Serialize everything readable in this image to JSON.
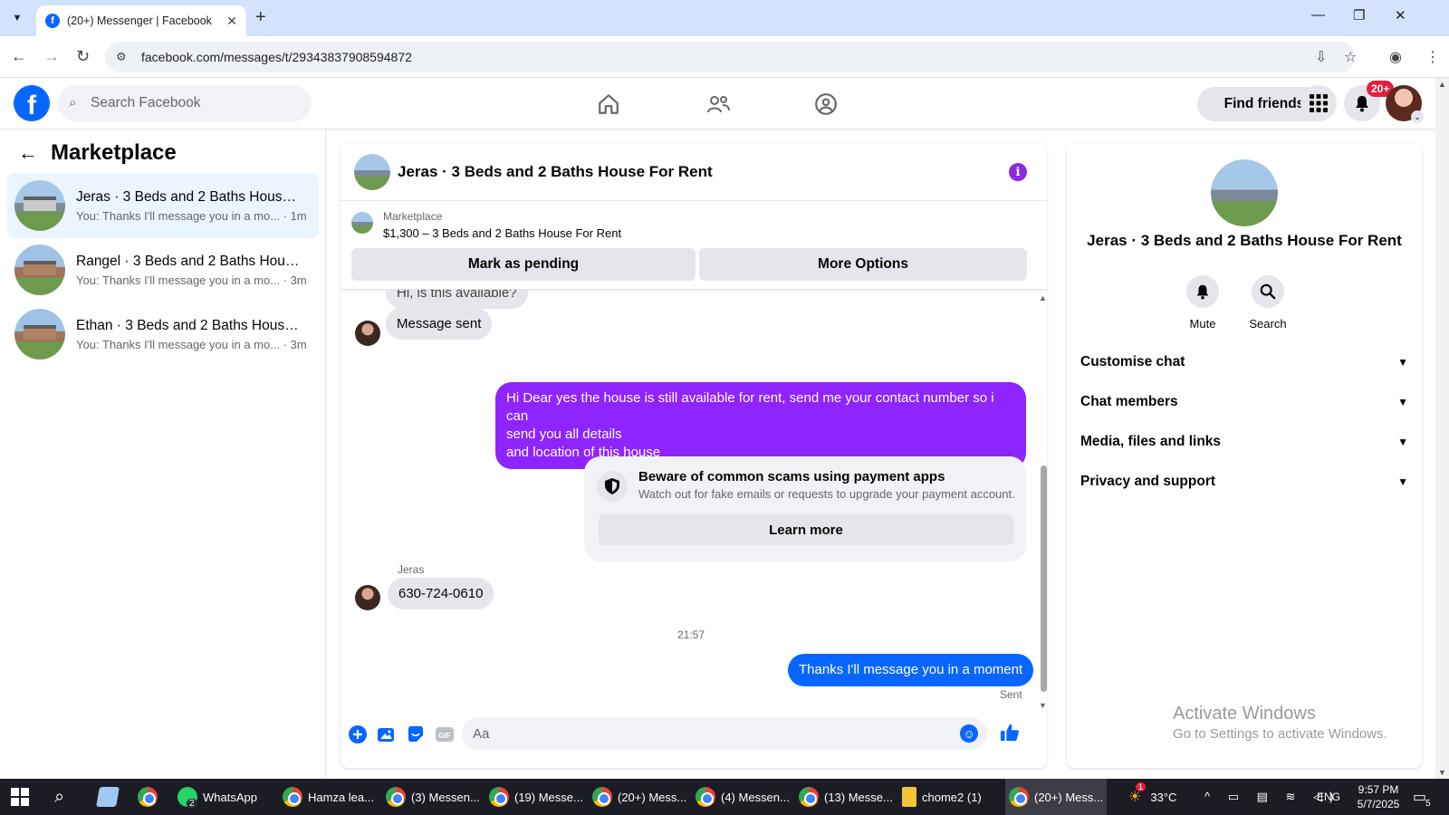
{
  "browser": {
    "tab_title": "(20+) Messenger | Facebook",
    "url": "facebook.com/messages/t/29343837908594872"
  },
  "fb": {
    "logo": "f",
    "search_placeholder": "Search Facebook",
    "find_friends": "Find friends",
    "notif_count": "20+"
  },
  "left": {
    "title": "Marketplace",
    "conversations": [
      {
        "name": "Jeras · 3 Beds and 2 Baths House F...",
        "preview": "You: Thanks I'll message you in a mo...",
        "time": "· 1m"
      },
      {
        "name": "Rangel · 3 Beds and 2 Baths House...",
        "preview": "You: Thanks I'll message you in a mo...",
        "time": "· 3m"
      },
      {
        "name": "Ethan · 3 Beds and 2 Baths House ...",
        "preview": "You: Thanks I'll message you in a mo...",
        "time": "· 3m"
      }
    ]
  },
  "chat": {
    "title": "Jeras · 3 Beds and 2 Baths House For Rent",
    "marketplace_label": "Marketplace",
    "listing": "$1,300 – 3 Beds and 2 Baths House For Rent",
    "mark_pending": "Mark as pending",
    "more_options": "More Options",
    "messages": {
      "partial": "Hi, is this available?",
      "message_sent": "Message sent",
      "reply_line1": "Hi Dear yes the house is still available for rent, send me your contact number so i can",
      "reply_line2": "send you all details",
      "reply_line3": "and location of this house",
      "scam_title": "Beware of common scams using payment apps",
      "scam_sub": "Watch out for fake emails or requests to upgrade your payment account.",
      "learn_more": "Learn more",
      "sender": "Jeras",
      "phone": "630-724-0610",
      "time": "21:57",
      "last": "Thanks I'll message you in a moment",
      "status": "Sent"
    },
    "composer_placeholder": "Aa",
    "gif_label": "GIF"
  },
  "info": {
    "title": "Jeras · 3 Beds and 2 Baths House For Rent",
    "mute": "Mute",
    "search": "Search",
    "sections": [
      "Customise chat",
      "Chat members",
      "Media, files and links",
      "Privacy and support"
    ]
  },
  "watermark": {
    "line1": "Activate Windows",
    "line2": "Go to Settings to activate Windows."
  },
  "taskbar": {
    "items": [
      "WhatsApp",
      "Hamza lea...",
      "(3) Messen...",
      "(19) Messe...",
      "(20+) Mess...",
      "(4) Messen...",
      "(13) Messe...",
      "chome2 (1)",
      "(20+) Mess..."
    ],
    "whatsapp_badge": "2",
    "weather_alert": "1",
    "temperature": "33°C",
    "language": "ENG",
    "time": "9:57 PM",
    "date": "5/7/2025",
    "notif_count": "5"
  },
  "colors": {
    "fb_blue": "#0866ff",
    "purple_bubble": "#8e24ff",
    "active_conv": "#ebf5ff",
    "badge_red": "#e41e3f"
  }
}
